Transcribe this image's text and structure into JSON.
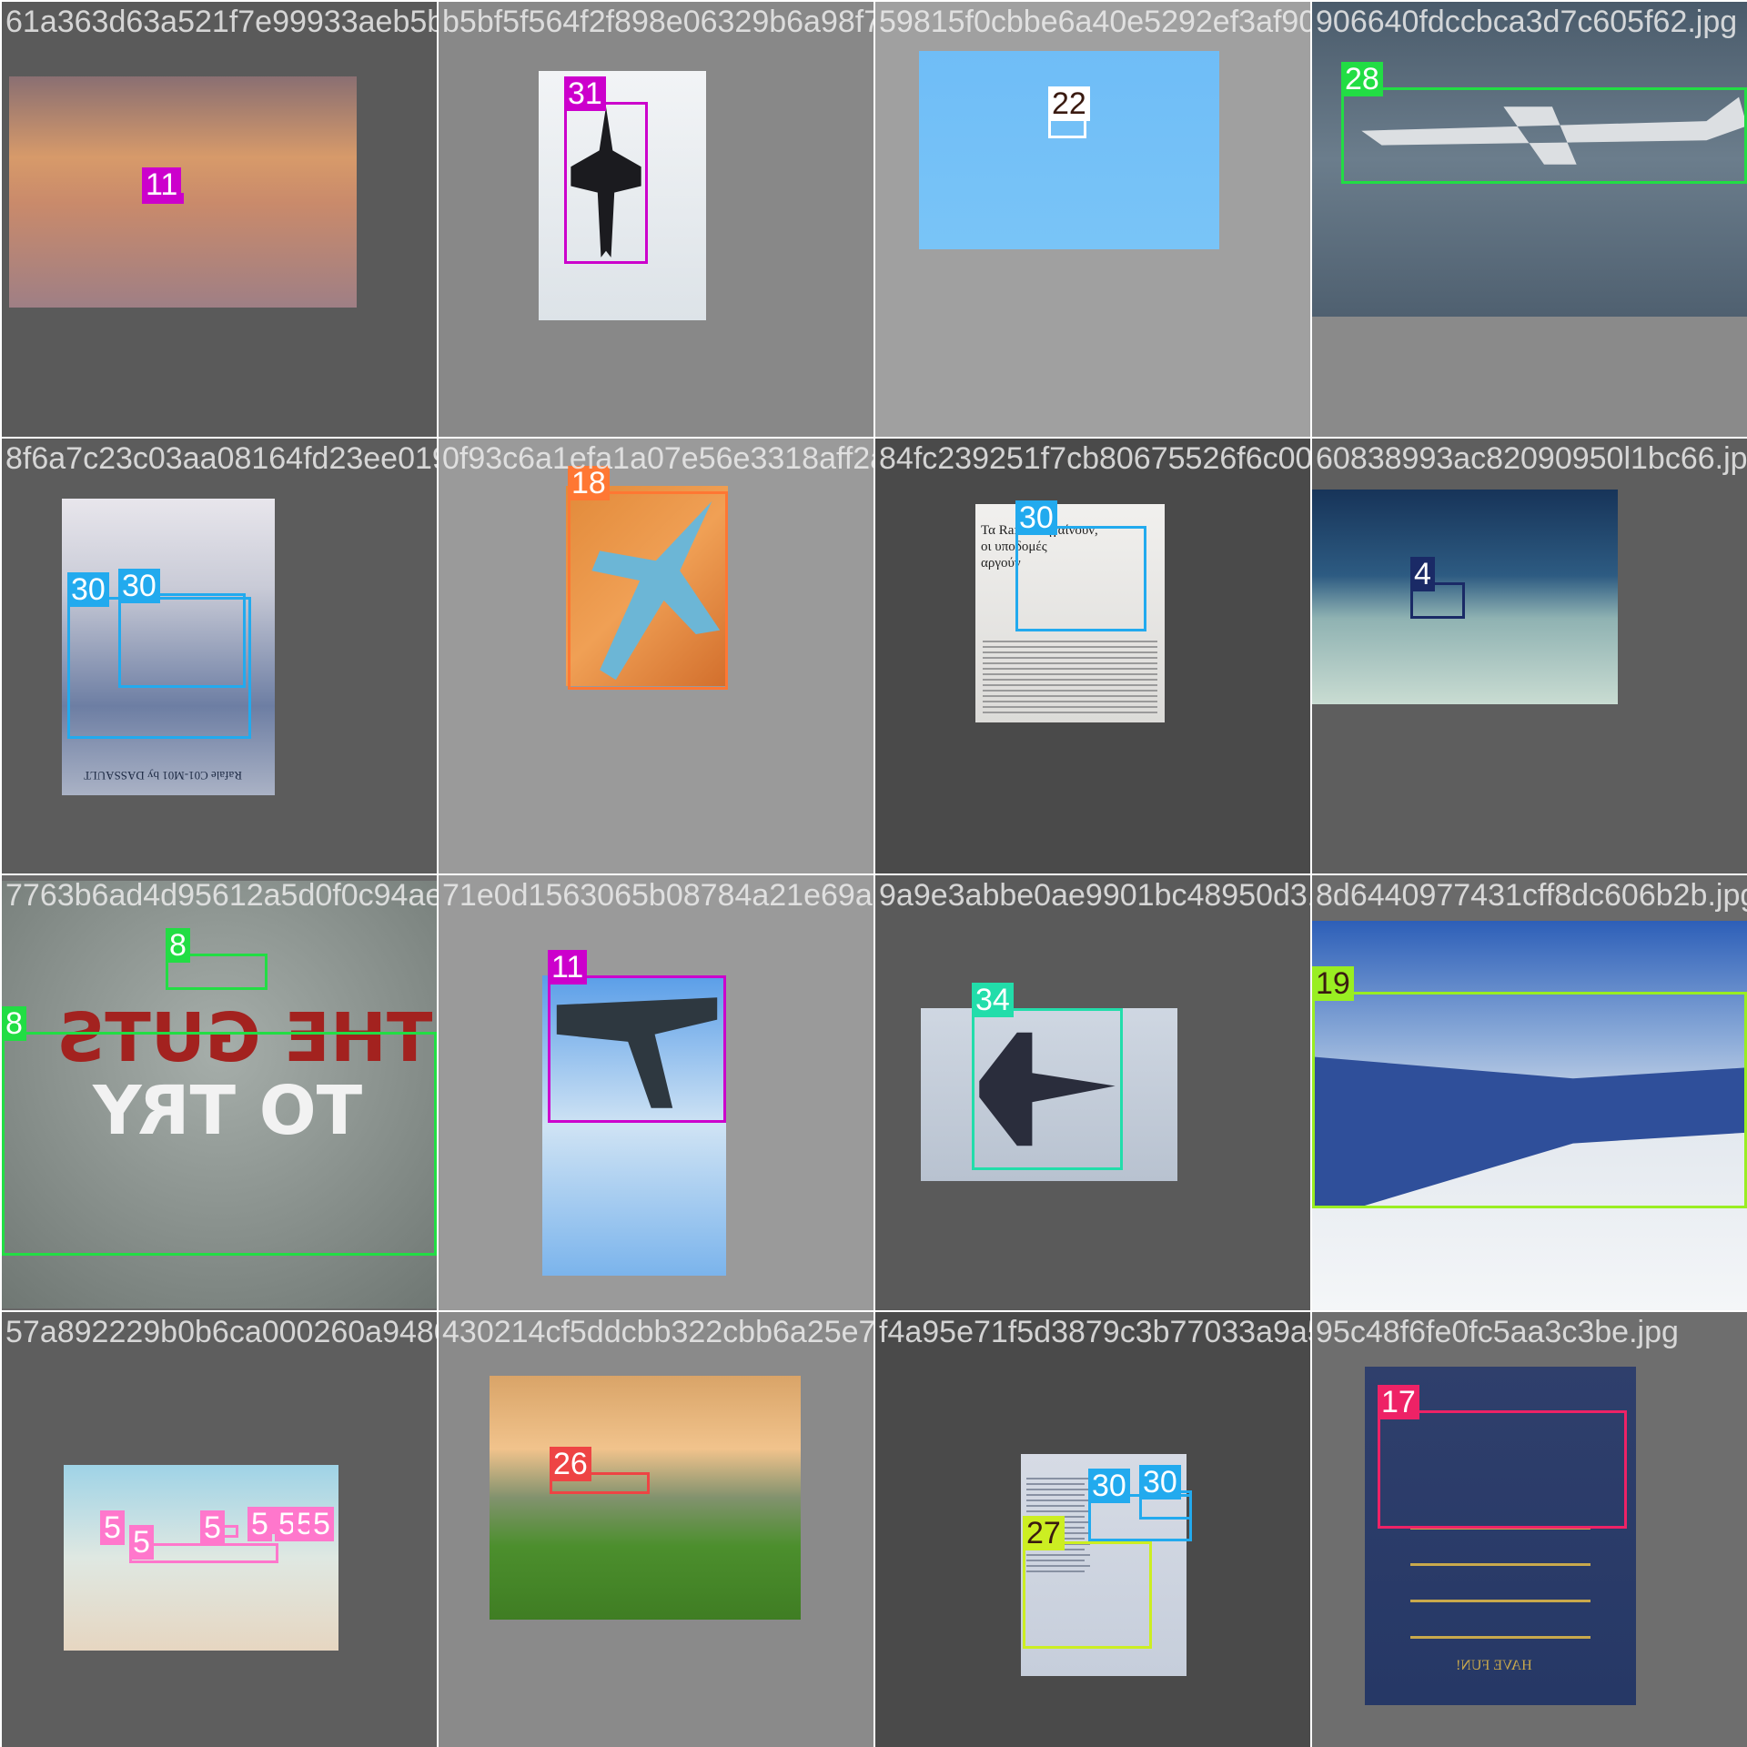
{
  "tiles": [
    {
      "filename": "61a363d63a521f7e99933aeb5b7524594.jpg",
      "background": "#5a5a5a",
      "labels": [
        {
          "text": "11",
          "color": "#cc00cc"
        }
      ]
    },
    {
      "filename": "b5bf5f564f2f898e06329b6a98f7c3b.jpg",
      "background": "#888888",
      "labels": [
        {
          "text": "31",
          "color": "#cc00cc"
        }
      ]
    },
    {
      "filename": "59815f0cbbe6a40e5292ef3af9068f4fb.jpg",
      "background": "#a0a0a0",
      "labels": [
        {
          "text": "22",
          "color": "#ffffff"
        }
      ]
    },
    {
      "filename": "906640fdccbca3d7c605f62.jpg",
      "background": "#8a8a8a",
      "labels": [
        {
          "text": "28",
          "color": "#22dd44"
        }
      ]
    },
    {
      "filename": "8f6a7c23c03aa08164fd23ee0195508d.jpg",
      "background": "#5c5c5c",
      "labels": [
        {
          "text": "30",
          "color": "#22aaee"
        },
        {
          "text": "30",
          "color": "#22aaee"
        }
      ]
    },
    {
      "filename": "0f93c6a1efa1a07e56e3318aff2a85201.jpg",
      "background": "#9a9a9a",
      "labels": [
        {
          "text": "18",
          "color": "#ff7733"
        }
      ]
    },
    {
      "filename": "84fc239251f7cb80675526f6c0083900.jpg",
      "background": "#4a4a4a",
      "labels": [
        {
          "text": "30",
          "color": "#22aaee"
        }
      ]
    },
    {
      "filename": "60838993ac82090950l1bc66.jpg",
      "background": "#5e5e5e",
      "labels": [
        {
          "text": "4",
          "color": "#1a2a66"
        }
      ]
    },
    {
      "filename": "7763b6ad4d95612a5d0f0c94ae0b376f.jpg",
      "background": "#6a6a6a",
      "labels": [
        {
          "text": "8",
          "color": "#22dd44"
        },
        {
          "text": "8",
          "color": "#22dd44"
        }
      ]
    },
    {
      "filename": "71e0d1563065b08784a21e69a93abbe.jpg",
      "background": "#9a9a9a",
      "labels": [
        {
          "text": "11",
          "color": "#cc00cc"
        }
      ]
    },
    {
      "filename": "9a9e3abbe0ae9901bc48950d314d877.jpg",
      "background": "#5a5a5a",
      "labels": [
        {
          "text": "34",
          "color": "#22ddaa"
        }
      ]
    },
    {
      "filename": "8d6440977431cff8dc606b2b.jpg",
      "background": "#6a6a6a",
      "labels": [
        {
          "text": "19",
          "color": "#99ee22"
        }
      ]
    },
    {
      "filename": "57a892229b0b6ca000260a9480149cf75.jpg",
      "background": "#5e5e5e",
      "labels": [
        {
          "text": "5",
          "color": "#ff77cc"
        },
        {
          "text": "5",
          "color": "#ff77cc"
        },
        {
          "text": "5",
          "color": "#ff77cc"
        },
        {
          "text": "5",
          "color": "#ff77cc"
        },
        {
          "text": "5",
          "color": "#ff77cc"
        },
        {
          "text": "5",
          "color": "#ff77cc"
        },
        {
          "text": "5",
          "color": "#ff77cc"
        }
      ]
    },
    {
      "filename": "430214cf5ddcbb322cbb6a25e7f5d.jpg",
      "background": "#8a8a8a",
      "labels": [
        {
          "text": "26",
          "color": "#ee4444"
        }
      ]
    },
    {
      "filename": "f4a95e71f5d3879c3b77033a9a54831844.jpg",
      "background": "#4a4a4a",
      "labels": [
        {
          "text": "30",
          "color": "#22aaee"
        },
        {
          "text": "30",
          "color": "#22aaee"
        },
        {
          "text": "27",
          "color": "#ccee22"
        }
      ]
    },
    {
      "filename": "95c48f6fe0fc5aa3c3be.jpg",
      "background": "#6e6e6e",
      "labels": [
        {
          "text": "17",
          "color": "#ee2266"
        }
      ]
    }
  ],
  "embedded_text": {
    "newspaper_headline": "Τα Rafale πηγαίνουν,\nοι υποδομές\nαργούν",
    "poster_slogan_lines": [
      "THE GUTS",
      "TO TRY"
    ],
    "rafale_caption": "Rafale C01-M01 by DASSAULT",
    "poster_footer": "HAVE FUN!"
  }
}
